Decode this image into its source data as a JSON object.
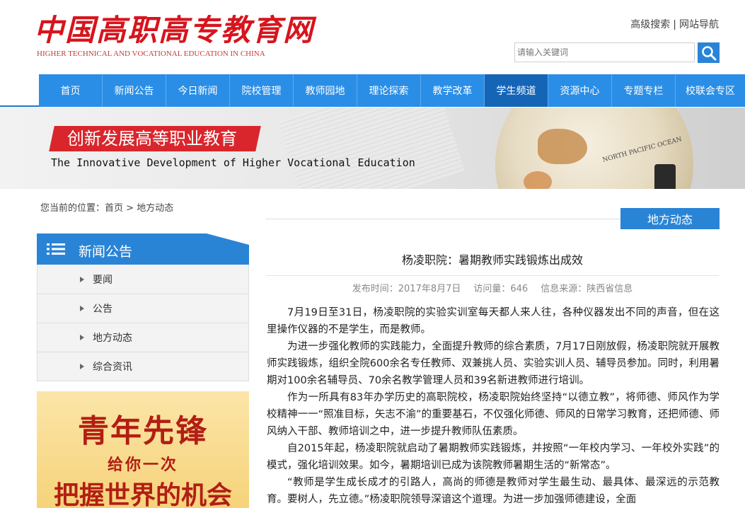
{
  "header": {
    "logo_cn": "中国高职高专教育网",
    "logo_en": "HIGHER TECHNICAL AND VOCATIONAL EDUCATION IN CHINA",
    "links": [
      "高级搜索",
      "网站导航"
    ],
    "search_placeholder": "请输入关键词"
  },
  "nav": {
    "items": [
      "首页",
      "新闻公告",
      "今日新闻",
      "院校管理",
      "教师园地",
      "理论探索",
      "教学改革",
      "学生频道",
      "资源中心",
      "专题专栏",
      "校联会专区"
    ],
    "active": "学生频道"
  },
  "banner": {
    "slogan": "创新发展高等职业教育",
    "subtitle": "The Innovative Development of Higher Vocational Education",
    "globe_label": "NORTH PACIFIC OCEAN"
  },
  "breadcrumb": {
    "prefix": "您当前的位置：",
    "home": "首页",
    "sep": " > ",
    "current": "地方动态"
  },
  "section_tag": "地方动态",
  "sidebar": {
    "title": "新闻公告",
    "items": [
      "要闻",
      "公告",
      "地方动态",
      "综合资讯"
    ]
  },
  "ad": {
    "title": "青年先锋",
    "sub": "给你一次",
    "main": "把握世界的机会"
  },
  "article": {
    "title": "杨凌职院：暑期教师实践锻炼出成效",
    "date": "发布时间：2017年8月7日",
    "views": "访问量：646",
    "source": "信息来源：陕西省信息",
    "paragraphs": [
      "7月19日至31日，杨凌职院的实验实训室每天都人来人往，各种仪器发出不同的声音，但在这里操作仪器的不是学生，而是教师。",
      "为进一步强化教师的实践能力，全面提升教师的综合素质，7月17日刚放假，杨凌职院就开展教师实践锻炼，组织全院600余名专任教师、双兼挑人员、实验实训人员、辅导员参加。同时，利用暑期对100余名辅导员、70余名教学管理人员和39名新进教师进行培训。",
      "作为一所具有83年办学历史的高职院校，杨凌职院始终坚持“以德立教”，将师德、师风作为学校精神一一“照准目标，矢志不渝”的重要基石，不仅强化师德、师风的日常学习教育，还把师德、师风纳入干部、教师培训之中，进一步提升教师队伍素质。",
      "自2015年起，杨凌职院就启动了暑期教师实践锻炼，并按照“一年校内学习、一年校外实践”的模式，强化培训效果。如今，暑期培训已成为该院教师暑期生活的“新常态”。",
      "“教师是学生成长成才的引路人，高尚的师德是教师对学生最生动、最具体、最深远的示范教育。要树人，先立德。”杨凌职院领导深谙这个道理。为进一步加强师德建设，全面"
    ]
  },
  "colors": {
    "primary_blue": "#2a84d6",
    "nav_blue": "#2a8ee6",
    "nav_active": "#1565b7",
    "logo_red": "#d7141d",
    "slogan_red": "#d9262c"
  }
}
